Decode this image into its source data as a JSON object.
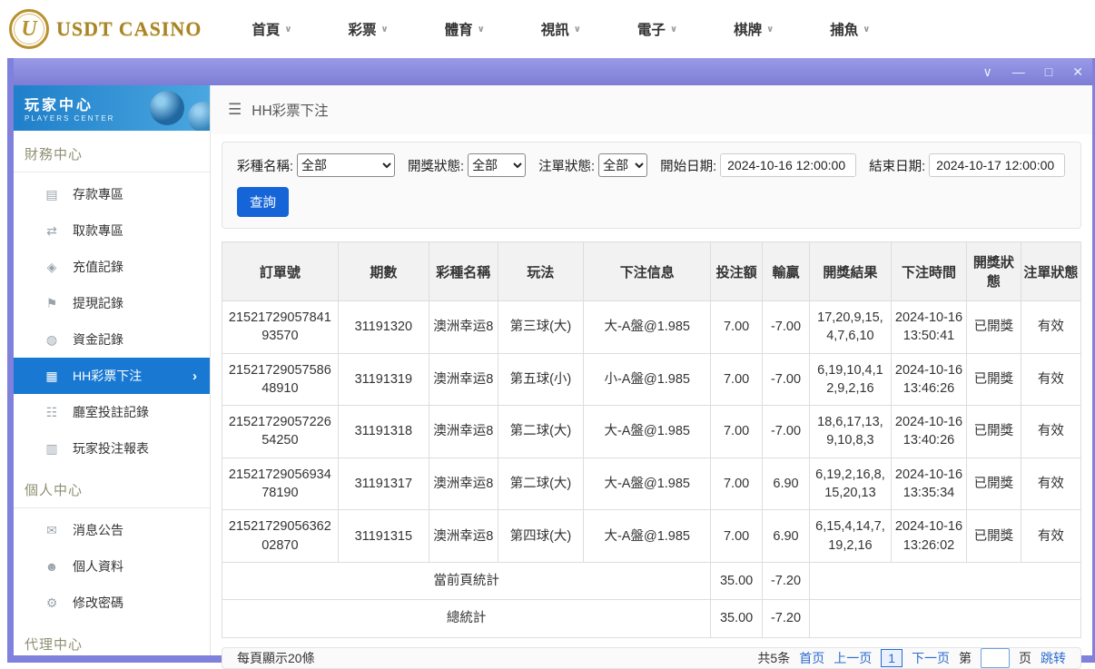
{
  "topnav": {
    "brand": "USDT CASINO",
    "logo_letter": "U",
    "chevron": "∨",
    "items": [
      {
        "label": "首頁"
      },
      {
        "label": "彩票"
      },
      {
        "label": "體育"
      },
      {
        "label": "視訊"
      },
      {
        "label": "電子"
      },
      {
        "label": "棋牌"
      },
      {
        "label": "捕魚"
      }
    ]
  },
  "window_controls": {
    "collapse": "∨",
    "minimize": "—",
    "maximize": "□",
    "close": "✕"
  },
  "sidebar": {
    "title": "玩家中心",
    "subtitle": "PLAYERS CENTER",
    "finance_section": "財務中心",
    "personal_section": "個人中心",
    "agent_section": "代理中心",
    "finance_items": [
      {
        "label": "存款專區",
        "icon": "▤"
      },
      {
        "label": "取款專區",
        "icon": "⇄"
      },
      {
        "label": "充值記錄",
        "icon": "◈"
      },
      {
        "label": "提現記錄",
        "icon": "⚑"
      },
      {
        "label": "資金記錄",
        "icon": "◍"
      },
      {
        "label": "HH彩票下注",
        "icon": "▦",
        "chevron": "›"
      },
      {
        "label": "廳室投註記錄",
        "icon": "☷"
      },
      {
        "label": "玩家投注報表",
        "icon": "▥"
      }
    ],
    "personal_items": [
      {
        "label": "消息公告",
        "icon": "✉"
      },
      {
        "label": "個人資料",
        "icon": "☻"
      },
      {
        "label": "修改密碼",
        "icon": "⚙"
      }
    ]
  },
  "breadcrumb": {
    "menu_icon": "☰",
    "title": "HH彩票下注"
  },
  "filters": {
    "lottery_label": "彩種名稱:",
    "lottery_value": "全部",
    "draw_status_label": "開獎狀態:",
    "draw_status_value": "全部",
    "order_status_label": "注單狀態:",
    "order_status_value": "全部",
    "start_label": "開始日期:",
    "start_value": "2024-10-16 12:00:00",
    "end_label": "結束日期:",
    "end_value": "2024-10-17 12:00:00",
    "query_button": "查詢"
  },
  "table": {
    "headers": [
      "訂單號",
      "期數",
      "彩種名稱",
      "玩法",
      "下注信息",
      "投注額",
      "輸贏",
      "開獎結果",
      "下注時間",
      "開獎狀態",
      "注單狀態"
    ],
    "rows": [
      {
        "order": "2152172905784193570",
        "period": "31191320",
        "lottery": "澳洲幸运8",
        "play": "第三球(大)",
        "bet_info": "大-A盤@1.985",
        "amount": "7.00",
        "winloss": "-7.00",
        "result": "17,20,9,15,4,7,6,10",
        "time": "2024-10-16 13:50:41",
        "draw_status": "已開獎",
        "order_status": "有效"
      },
      {
        "order": "2152172905758648910",
        "period": "31191319",
        "lottery": "澳洲幸运8",
        "play": "第五球(小)",
        "bet_info": "小-A盤@1.985",
        "amount": "7.00",
        "winloss": "-7.00",
        "result": "6,19,10,4,12,9,2,16",
        "time": "2024-10-16 13:46:26",
        "draw_status": "已開獎",
        "order_status": "有效"
      },
      {
        "order": "2152172905722654250",
        "period": "31191318",
        "lottery": "澳洲幸运8",
        "play": "第二球(大)",
        "bet_info": "大-A盤@1.985",
        "amount": "7.00",
        "winloss": "-7.00",
        "result": "18,6,17,13,9,10,8,3",
        "time": "2024-10-16 13:40:26",
        "draw_status": "已開獎",
        "order_status": "有效"
      },
      {
        "order": "2152172905693478190",
        "period": "31191317",
        "lottery": "澳洲幸运8",
        "play": "第二球(大)",
        "bet_info": "大-A盤@1.985",
        "amount": "7.00",
        "winloss": "6.90",
        "result": "6,19,2,16,8,15,20,13",
        "time": "2024-10-16 13:35:34",
        "draw_status": "已開獎",
        "order_status": "有效"
      },
      {
        "order": "2152172905636202870",
        "period": "31191315",
        "lottery": "澳洲幸运8",
        "play": "第四球(大)",
        "bet_info": "大-A盤@1.985",
        "amount": "7.00",
        "winloss": "6.90",
        "result": "6,15,4,14,7,19,2,16",
        "time": "2024-10-16 13:26:02",
        "draw_status": "已開獎",
        "order_status": "有效"
      }
    ],
    "page_summary": {
      "label": "當前頁統計",
      "amount": "35.00",
      "winloss": "-7.20"
    },
    "grand_summary": {
      "label": "總統計",
      "amount": "35.00",
      "winloss": "-7.20"
    }
  },
  "pagination": {
    "page_size_text": "每頁顯示20條",
    "total_text": "共5条",
    "first": "首页",
    "prev": "上一页",
    "current_page": "1",
    "next": "下一页",
    "page_prefix": "第",
    "page_suffix": "页",
    "jump": "跳转"
  }
}
